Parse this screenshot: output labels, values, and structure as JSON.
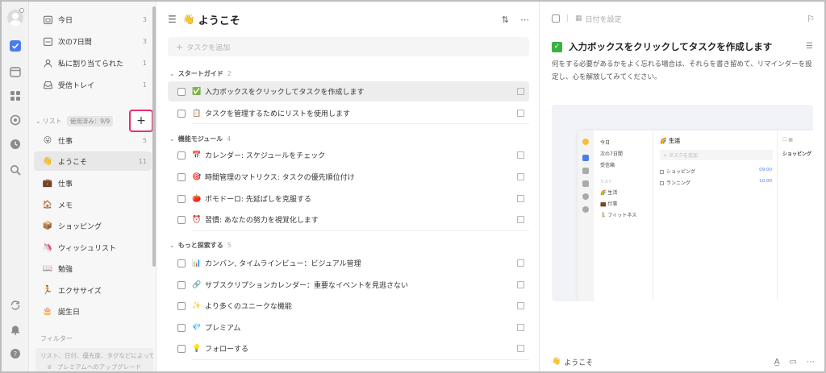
{
  "rail": {
    "icons": [
      "avatar",
      "checkbox-icon",
      "calendar-icon",
      "grid-icon",
      "target-icon",
      "clock-icon",
      "search-icon",
      "sync-icon",
      "bell-icon",
      "help-icon"
    ]
  },
  "sidebar": {
    "smart_lists": [
      {
        "label": "今日",
        "count": "3",
        "icon": "calendar-today-icon"
      },
      {
        "label": "次の7日間",
        "count": "3",
        "icon": "calendar-week-icon"
      },
      {
        "label": "私に割り当てられた",
        "count": "1",
        "icon": "person-icon"
      },
      {
        "label": "受信トレイ",
        "count": "1",
        "icon": "inbox-icon"
      }
    ],
    "section_label": "リスト",
    "usage_badge": "使用済み：9/9",
    "add_button": "+",
    "lists": [
      {
        "emoji": "😜",
        "label": "仕事",
        "count": "5"
      },
      {
        "emoji": "👋",
        "label": "ようこそ",
        "count": "11"
      },
      {
        "emoji": "💼",
        "label": "仕事",
        "count": ""
      },
      {
        "emoji": "🏠",
        "label": "メモ",
        "count": ""
      },
      {
        "emoji": "📦",
        "label": "ショッピング",
        "count": ""
      },
      {
        "emoji": "🦄",
        "label": "ウィッシュリスト",
        "count": ""
      },
      {
        "emoji": "📖",
        "label": "勉強",
        "count": ""
      },
      {
        "emoji": "🏃",
        "label": "エクササイズ",
        "count": ""
      },
      {
        "emoji": "🎂",
        "label": "誕生日",
        "count": ""
      }
    ],
    "filter_label": "フィルター",
    "filter_hint": "リスト、日付、優先度、タグなどによってフ",
    "upgrade_label": "プレミアムへのアップグレード"
  },
  "main": {
    "title_emoji": "👋",
    "title": "ようこそ",
    "add_task_placeholder": "タスクを追加",
    "sections": [
      {
        "name": "スタートガイド",
        "count": "2",
        "tasks": [
          {
            "emoji": "✅",
            "label": "入力ボックスをクリックしてタスクを作成します"
          },
          {
            "emoji": "📋",
            "label": "タスクを管理するためにリストを使用します"
          }
        ]
      },
      {
        "name": "機能モジュール",
        "count": "4",
        "tasks": [
          {
            "emoji": "📅",
            "label": "カレンダー: スケジュールをチェック"
          },
          {
            "emoji": "🎯",
            "label": "時間管理のマトリクス: タスクの優先順位付け"
          },
          {
            "emoji": "🍅",
            "label": "ポモドーロ: 先延ばしを克服する"
          },
          {
            "emoji": "⏰",
            "label": "習慣: あなたの努力を視覚化します"
          }
        ]
      },
      {
        "name": "もっと探索する",
        "count": "5",
        "tasks": [
          {
            "emoji": "📊",
            "label": "カンバン, タイムラインビュー：ビジュアル管理"
          },
          {
            "emoji": "🔗",
            "label": "サブスクリプションカレンダー：重要なイベントを見逃さない"
          },
          {
            "emoji": "✨",
            "label": "より多くのユニークな機能"
          },
          {
            "emoji": "💎",
            "label": "プレミアム"
          },
          {
            "emoji": "💡",
            "label": "フォローする"
          }
        ]
      }
    ]
  },
  "detail": {
    "date_placeholder": "日付を設定",
    "title": "入力ボックスをクリックしてタスクを作成します",
    "description": "何をする必要があるかをよく忘れる場合は、それらを書き留めて、リマインダーを設定し、心を解放してみてください。",
    "footer_list_emoji": "👋",
    "footer_list": "ようこそ",
    "preview": {
      "side_items": [
        "今日",
        "次の7日間",
        "受信箱"
      ],
      "side_section": "リスト",
      "side_lists": [
        "🌈 生活",
        "💼 仕事",
        "🏃 フィットネス"
      ],
      "mid_title": "🌈 生活",
      "mid_add": "+ タスクを追加",
      "mid_tasks": [
        {
          "label": "ショッピング",
          "time": "09:00"
        },
        {
          "label": "ランニング",
          "time": "10:00"
        }
      ],
      "right_title": "ショッピング"
    }
  }
}
